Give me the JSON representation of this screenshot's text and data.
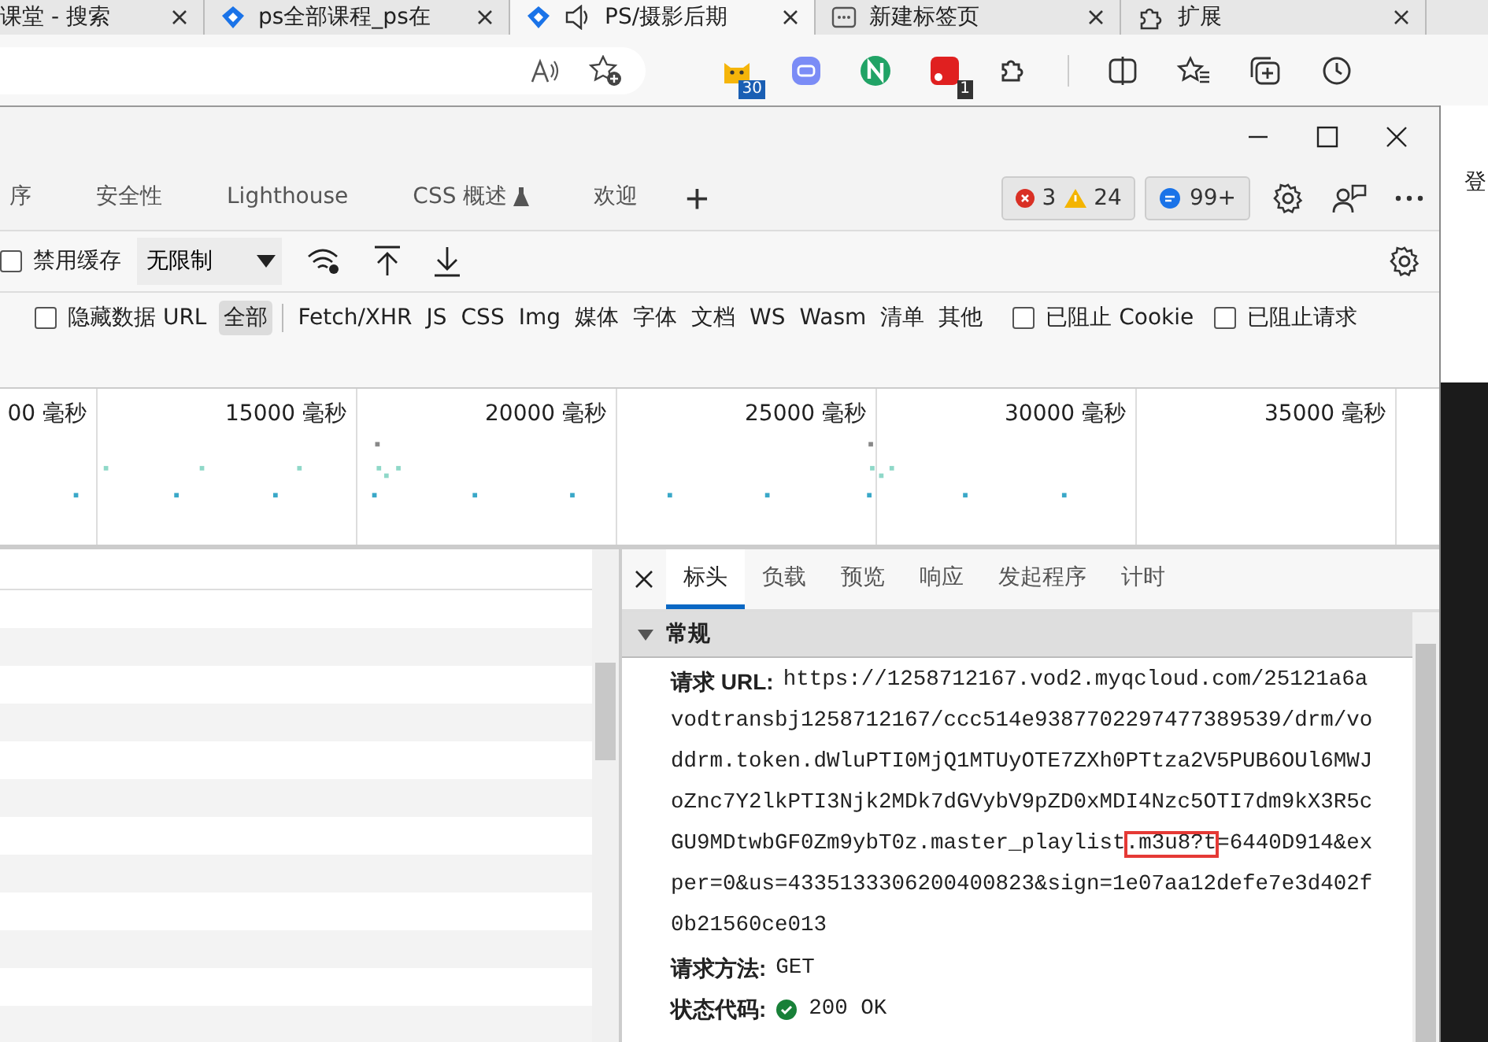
{
  "browser_tabs": [
    {
      "title": "课堂 - 搜索",
      "kind": "plain",
      "selected": false
    },
    {
      "title": "ps全部课程_ps在",
      "kind": "site",
      "selected": false
    },
    {
      "title": "PS/摄影后期",
      "kind": "audio",
      "selected": true
    },
    {
      "title": "新建标签页",
      "kind": "newtab",
      "selected": false
    },
    {
      "title": "扩展",
      "kind": "extensions",
      "selected": false
    }
  ],
  "extension_badges": [
    {
      "kind": "cat",
      "badge": "30"
    },
    {
      "kind": "bot"
    },
    {
      "kind": "n"
    },
    {
      "kind": "red",
      "badge": "1"
    }
  ],
  "devtools": {
    "tabs": [
      {
        "label": "序",
        "selected": false
      },
      {
        "label": "安全性",
        "selected": false
      },
      {
        "label": "Lighthouse",
        "selected": false
      },
      {
        "label": "CSS 概述",
        "selected": false,
        "experimental": true
      },
      {
        "label": "欢迎",
        "selected": false
      }
    ],
    "add_tab": "+",
    "issues": {
      "errors": "3",
      "warnings": "24",
      "messages": "99+"
    },
    "toolbar": {
      "disable_cache": {
        "label": "禁用缓存",
        "checked": false
      },
      "throttling": "无限制"
    },
    "filters": {
      "hide_data_urls": {
        "label": "隐藏数据 URL",
        "checked": false
      },
      "types": [
        {
          "label": "全部",
          "selected": true
        },
        {
          "label": "Fetch/XHR",
          "selected": false
        },
        {
          "label": "JS",
          "selected": false
        },
        {
          "label": "CSS",
          "selected": false
        },
        {
          "label": "Img",
          "selected": false
        },
        {
          "label": "媒体",
          "selected": false
        },
        {
          "label": "字体",
          "selected": false
        },
        {
          "label": "文档",
          "selected": false
        },
        {
          "label": "WS",
          "selected": false
        },
        {
          "label": "Wasm",
          "selected": false
        },
        {
          "label": "清单",
          "selected": false
        },
        {
          "label": "其他",
          "selected": false
        }
      ],
      "blocked": [
        {
          "label": "已阻止 Cookie",
          "checked": false
        },
        {
          "label": "已阻止请求",
          "checked": false
        }
      ]
    },
    "timeline": {
      "ticks": [
        "00 毫秒",
        "15000 毫秒",
        "20000 毫秒",
        "25000 毫秒",
        "30000 毫秒",
        "35000 毫秒"
      ]
    },
    "detail": {
      "tabs": [
        {
          "label": "标头",
          "selected": true
        },
        {
          "label": "负载",
          "selected": false
        },
        {
          "label": "预览",
          "selected": false
        },
        {
          "label": "响应",
          "selected": false
        },
        {
          "label": "发起程序",
          "selected": false
        },
        {
          "label": "计时",
          "selected": false
        }
      ],
      "section": {
        "title": "常规",
        "expanded": true,
        "url": {
          "label": "请求 URL:",
          "parts": [
            {
              "text": "https://1258712167.vod2.myqcloud.com/25121a6avodtransbj1258712167/ccc514e9387702297477389539/drm/voddrm.token.dWluPTI0MjQ1MTUyOTE7ZXh0PTtza2V5PUB6OUl6MWJoZnc7Y2lkPTI3Njk2MDk7dGVybV9pZD0xMDI4Nzc5OTI7dm9kX3R5cGU9MDtwbGF0Zm9ybT0z.master_playlist",
              "highlighted": false
            },
            {
              "text": ".m3u8?t",
              "highlighted": true
            },
            {
              "text": "=6440D914&exper=0&us=4335133306200400823&sign=1e07aa12defe7e3d402f0b21560ce013",
              "highlighted": false
            }
          ]
        },
        "method": {
          "label": "请求方法:",
          "value": "GET"
        },
        "status": {
          "label": "状态代码:",
          "value": "200 OK",
          "ok": true
        }
      }
    }
  },
  "side_text": "登"
}
